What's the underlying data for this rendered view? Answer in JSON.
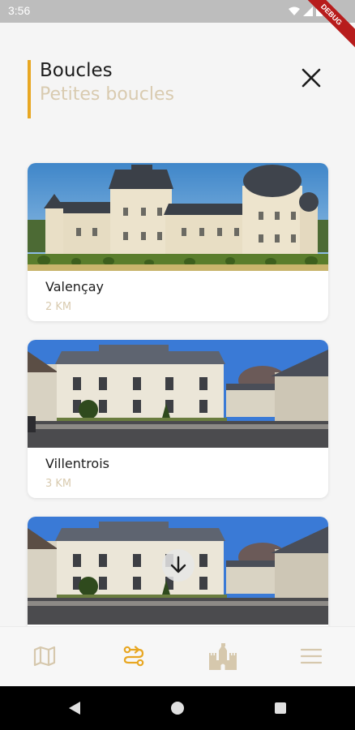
{
  "status_bar": {
    "time": "3:56",
    "debug_label": "DEBUG"
  },
  "header": {
    "title": "Boucles",
    "subtitle": "Petites boucles"
  },
  "cards": [
    {
      "title": "Valençay",
      "distance": "2 KM"
    },
    {
      "title": "Villentrois",
      "distance": "3 KM"
    },
    {
      "title": "",
      "distance": ""
    }
  ],
  "bottom_nav": {
    "items": [
      {
        "icon": "map-icon",
        "active": false
      },
      {
        "icon": "route-icon",
        "active": true
      },
      {
        "icon": "castle-icon",
        "active": false
      },
      {
        "icon": "menu-icon",
        "active": false
      }
    ]
  },
  "colors": {
    "accent": "#e8a722",
    "muted": "#d9cbb0",
    "text": "#1c1c1c"
  }
}
